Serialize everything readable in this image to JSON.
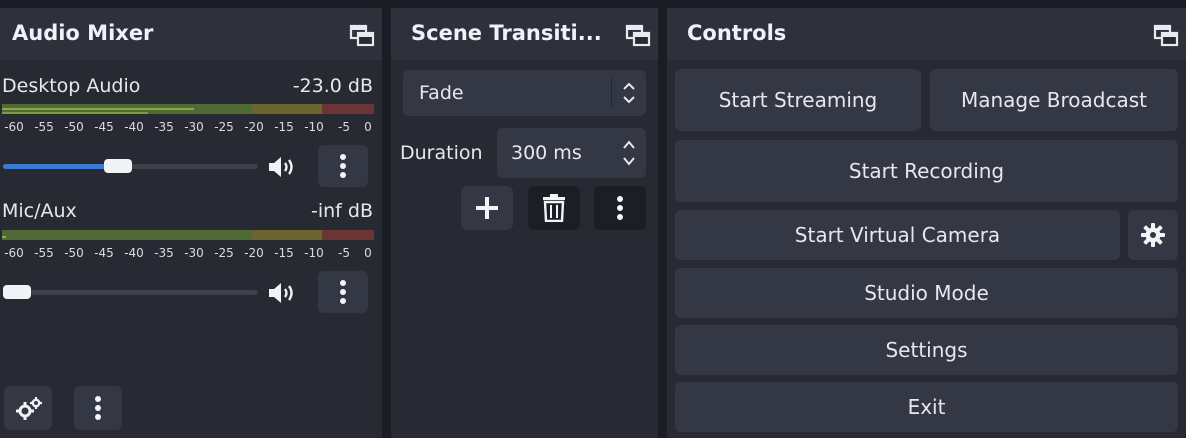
{
  "audio_mixer": {
    "title": "Audio Mixer",
    "channels": [
      {
        "name": "Desktop Audio",
        "level": "-23.0 dB",
        "volume_fraction": 0.45
      },
      {
        "name": "Mic/Aux",
        "level": "-inf dB",
        "volume_fraction": 0.05
      }
    ],
    "meter_ticks": [
      "-60",
      "-55",
      "-50",
      "-45",
      "-40",
      "-35",
      "-30",
      "-25",
      "-20",
      "-15",
      "-10",
      "-5",
      "0"
    ]
  },
  "scene_transitions": {
    "title": "Scene Transiti...",
    "transition_value": "Fade",
    "duration_label": "Duration",
    "duration_value": "300 ms"
  },
  "controls": {
    "title": "Controls",
    "start_streaming": "Start Streaming",
    "manage_broadcast": "Manage Broadcast",
    "start_recording": "Start Recording",
    "start_virtual_camera": "Start Virtual Camera",
    "studio_mode": "Studio Mode",
    "settings": "Settings",
    "exit": "Exit"
  },
  "icons": {
    "undock": "undock-icon",
    "volume": "speaker-icon",
    "more": "kebab-icon",
    "add": "plus-icon",
    "remove": "trash-icon",
    "settings": "gear-icon",
    "advanced_audio": "gears-icon",
    "spin": "up-down-arrows-icon"
  },
  "colors": {
    "accent": "#3a7bd5",
    "panel": "#272a33",
    "button": "#343844",
    "meter_green": "#4f6a34",
    "meter_yellow": "#6b6532",
    "meter_red": "#6a3534"
  }
}
